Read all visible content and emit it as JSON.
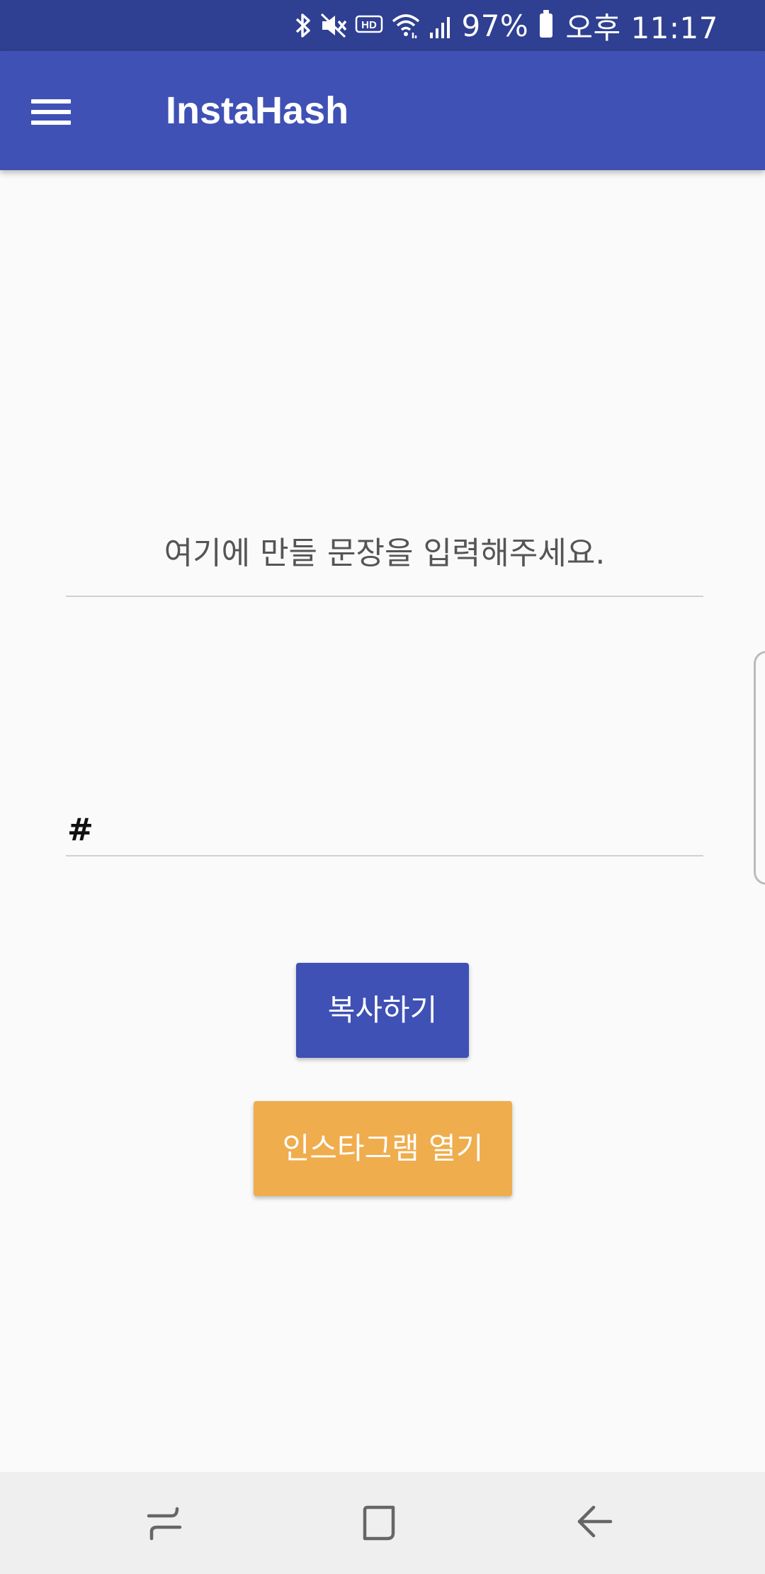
{
  "status_bar": {
    "battery_percent": "97%",
    "time": "오후 11:17",
    "icons": [
      "bluetooth-icon",
      "mute-icon",
      "hd-icon",
      "wifi-icon",
      "signal-icon",
      "battery-icon"
    ]
  },
  "app_bar": {
    "title": "InstaHash",
    "menu_icon": "menu-icon"
  },
  "form": {
    "sentence_placeholder": "여기에 만들 문장을 입력해주세요.",
    "hashtag_value": "#"
  },
  "buttons": {
    "copy_label": "복사하기",
    "instagram_label": "인스타그램 열기"
  },
  "nav_bar": {
    "icons": [
      "recents-icon",
      "home-icon",
      "back-icon"
    ]
  },
  "colors": {
    "status_bar": "#2f3f92",
    "app_bar": "#3f51b5",
    "copy_button": "#3f51b5",
    "instagram_button": "#efad4d",
    "background": "#fafafa"
  }
}
